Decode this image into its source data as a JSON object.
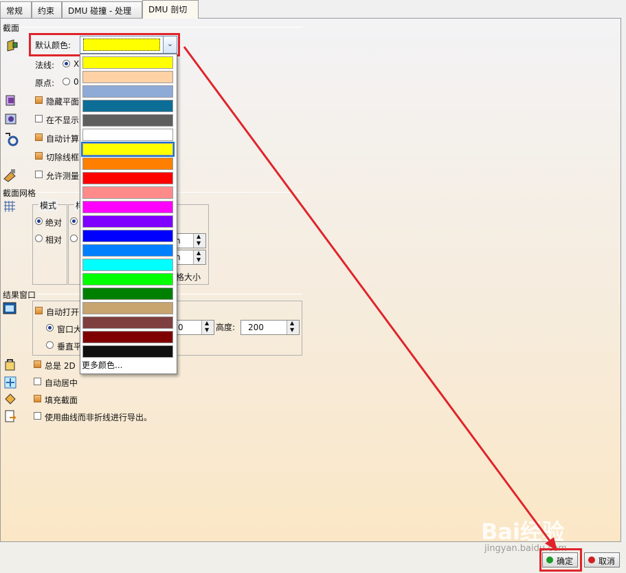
{
  "tabs": [
    "常规",
    "约束",
    "DMU 碰撞 - 处理",
    "DMU 剖切"
  ],
  "section": {
    "title": "截面",
    "default_color_label": "默认颜色:",
    "selected_color": "#ffff00",
    "normal_label": "法线:",
    "normal_value": "X",
    "origin_label": "原点:",
    "origin_value": "0",
    "hide_plane": "隐藏平面",
    "not_show": "在不显示",
    "auto_calc": "自动计算",
    "cut_wire": "切除线框",
    "allow_measure": "允许测量"
  },
  "grid": {
    "title": "截面网格",
    "mode_title": "模式",
    "style_title": "样",
    "absolute": "绝对",
    "relative": "相对",
    "unit1": "n",
    "unit2": "n",
    "grid_size": "格大小"
  },
  "result": {
    "title": "结果窗口",
    "auto_open": "自动打开",
    "window_size": "窗口大",
    "vertical": "垂直平",
    "width_value": "0",
    "height_label": "高度:",
    "height_value": "200"
  },
  "options": {
    "always_2d": "总是 2D",
    "auto_center": "自动居中",
    "fill_section": "填充截面",
    "export_curves": "使用曲线而非折线进行导出。"
  },
  "color_list": [
    "#ffff00",
    "#ffd2a6",
    "#8eaad6",
    "#0c6d96",
    "#5e5e5e",
    "#ffffff",
    "#ffff00",
    "#ff7f00",
    "#ff0000",
    "#ff8a8a",
    "#ff00ff",
    "#7f00ff",
    "#0000ff",
    "#0080ff",
    "#00ffff",
    "#00ff00",
    "#008000",
    "#c8a46e",
    "#7f3f3f",
    "#7f0000",
    "#101010"
  ],
  "more_colors": "更多颜色...",
  "buttons": {
    "ok": "确定",
    "cancel": "取消"
  },
  "watermark": {
    "brand": "Bai经验",
    "url": "jingyan.baidu.com"
  }
}
